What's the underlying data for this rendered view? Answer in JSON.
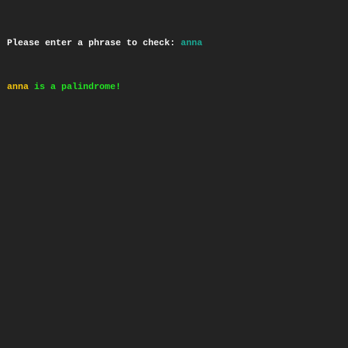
{
  "terminal": {
    "prompt": "Please enter a phrase to check: ",
    "input_value": "anna",
    "result_phrase": "anna",
    "result_message": " is a palindrome!"
  },
  "colors": {
    "background": "#232323",
    "prompt": "#f2f2f2",
    "input": "#1aa894",
    "echo": "#f2c40f",
    "success": "#23e023"
  }
}
